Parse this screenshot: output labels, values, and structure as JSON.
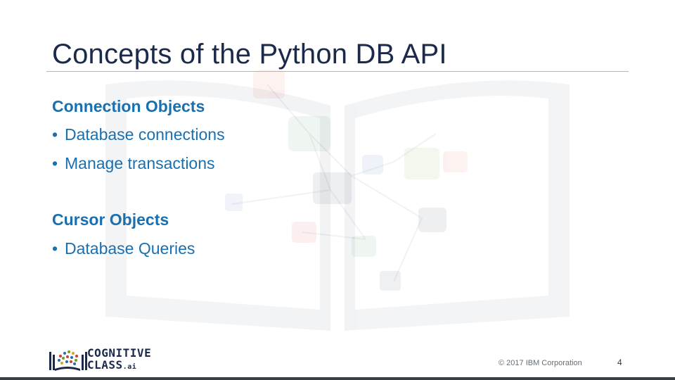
{
  "slide": {
    "title": "Concepts of the Python DB API",
    "sections": [
      {
        "heading": "Connection Objects",
        "bullets": [
          "Database connections",
          "Manage transactions"
        ]
      },
      {
        "heading": "Cursor Objects",
        "bullets": [
          "Database Queries"
        ]
      }
    ],
    "bullet_glyph": "•"
  },
  "footer": {
    "copyright": "© 2017 IBM Corporation",
    "page_number": "4",
    "logo": {
      "line1": "COGNITIVE",
      "line2": "CLASS",
      "suffix": ".ai"
    }
  },
  "colors": {
    "title": "#1b2a4a",
    "accent": "#1a6faf",
    "rule": "#a8b8c4"
  }
}
